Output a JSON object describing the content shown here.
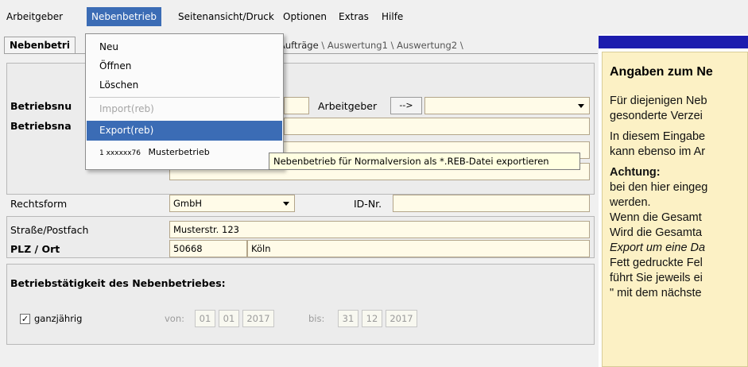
{
  "menubar": {
    "items": [
      "Arbeitgeber",
      "Nebenbetrieb",
      "Seitenansicht/Druck",
      "Optionen",
      "Extras",
      "Hilfe"
    ],
    "active_index": 1
  },
  "tabs": {
    "active": "Nebenbetri",
    "rest_first": "Aufträge",
    "rest_sep": "\\",
    "rest_second": "Auswertung1",
    "rest_third": "Auswertung2"
  },
  "form": {
    "betriebsnummer_label": "Betriebsnu",
    "betriebsname_label": "Betriebsna",
    "arbeitgeber_label": "Arbeitgeber",
    "arbeitgeber_button": "-->",
    "rechtsform_label": "Rechtsform",
    "rechtsform_value": "GmbH",
    "idnr_label": "ID-Nr.",
    "strasse_label": "Straße/Postfach",
    "strasse_value": "Musterstr. 123",
    "plzort_label": "PLZ  / Ort",
    "plz_value": "50668",
    "ort_value": "Köln",
    "taetigkeit_heading": "Betriebstätigkeit des Nebenbetriebes:",
    "ganzjaehrig_label": "ganzjährig",
    "ganzjaehrig_checked": "✓",
    "von_label": "von:",
    "von_day": "01",
    "von_month": "01",
    "von_year": "2017",
    "bis_label": "bis:",
    "bis_day": "31",
    "bis_month": "12",
    "bis_year": "2017"
  },
  "dropdown": {
    "neu": "Neu",
    "oeffnen": "Öffnen",
    "loeschen": "Löschen",
    "import": "Import(reb)",
    "export": "Export(reb)",
    "recent_number": "1 xxxxxx76",
    "recent_name": "Musterbetrieb"
  },
  "tooltip": "Nebenbetrieb für Normalversion als *.REB-Datei exportieren",
  "help": {
    "title": "Angaben zum Ne",
    "lines": [
      "Für diejenigen Neb",
      "gesonderte Verzei",
      "In diesem Eingabe",
      "kann ebenso im Ar",
      "Achtung:",
      "bei den hier eingeg",
      "werden.",
      "Wenn die Gesamt",
      "Wird die Gesamta",
      "Export um eine Da",
      "Fett gedruckte Fel",
      "führt Sie jeweils ei",
      "\" mit dem nächste"
    ]
  },
  "colors": {
    "menu_highlight": "#3b6cb5",
    "field_bg": "#fffbe8",
    "help_bg": "#fcf1c5",
    "title_bar": "#1c1cae"
  }
}
